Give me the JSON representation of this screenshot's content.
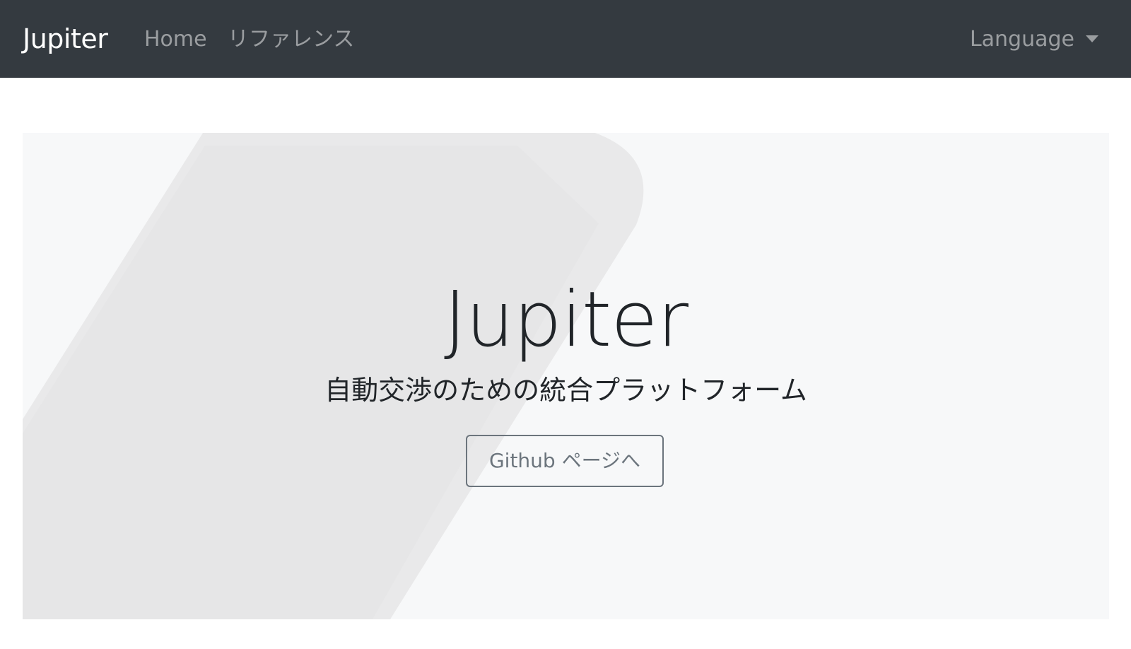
{
  "navbar": {
    "brand": "Jupiter",
    "links": [
      {
        "label": "Home"
      },
      {
        "label": "リファレンス"
      }
    ],
    "language_label": "Language"
  },
  "hero": {
    "title": "Jupiter",
    "subtitle": "自動交渉のための統合プラットフォーム",
    "button_label": "Github ページへ"
  },
  "colors": {
    "navbar_bg": "#343a40",
    "jumbotron_bg": "#f7f8f9",
    "button_outline": "#6c757d"
  }
}
